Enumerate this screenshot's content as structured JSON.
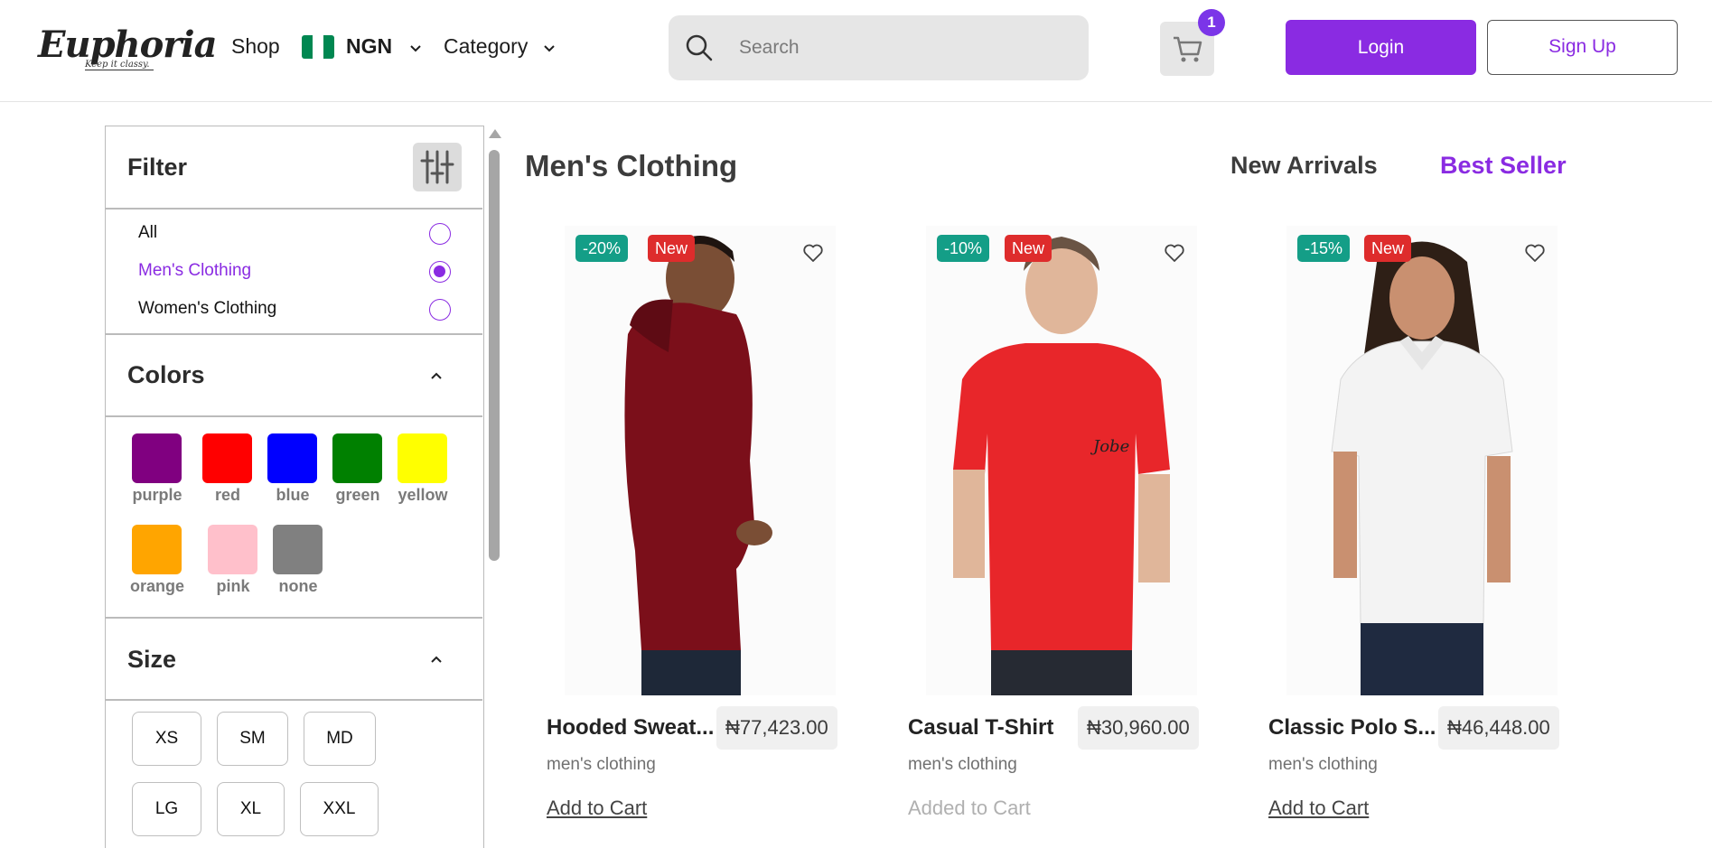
{
  "header": {
    "logo_text": "Euphoria",
    "logo_tagline": "Keep it classy.",
    "nav_shop": "Shop",
    "currency": "NGN",
    "nav_category": "Category",
    "search_placeholder": "Search",
    "cart_count": "1",
    "login_label": "Login",
    "signup_label": "Sign Up"
  },
  "sidebar": {
    "filter_title": "Filter",
    "categories": [
      {
        "label": "All",
        "selected": false
      },
      {
        "label": "Men's Clothing",
        "selected": true
      },
      {
        "label": "Women's Clothing",
        "selected": false
      }
    ],
    "colors_title": "Colors",
    "colors": [
      {
        "label": "purple",
        "hex": "#800080"
      },
      {
        "label": "red",
        "hex": "#ff0000"
      },
      {
        "label": "blue",
        "hex": "#0000ff"
      },
      {
        "label": "green",
        "hex": "#008000"
      },
      {
        "label": "yellow",
        "hex": "#ffff00"
      },
      {
        "label": "orange",
        "hex": "#ffa500"
      },
      {
        "label": "pink",
        "hex": "#ffc0cb"
      },
      {
        "label": "none",
        "hex": "#808080"
      }
    ],
    "size_title": "Size",
    "sizes": [
      "XS",
      "SM",
      "MD",
      "LG",
      "XL",
      "XXL"
    ]
  },
  "main": {
    "title": "Men's Clothing",
    "tab_new_arrivals": "New Arrivals",
    "tab_best_seller": "Best Seller",
    "products": [
      {
        "name": "Hooded Sweat...",
        "price": "₦77,423.00",
        "category": "men's clothing",
        "discount": "-20%",
        "badge": "New",
        "cart_label": "Add to Cart"
      },
      {
        "name": "Casual T-Shirt",
        "price": "₦30,960.00",
        "category": "men's clothing",
        "discount": "-10%",
        "badge": "New",
        "cart_label": "Added to Cart"
      },
      {
        "name": "Classic Polo S...",
        "price": "₦46,448.00",
        "category": "men's clothing",
        "discount": "-15%",
        "badge": "New",
        "cart_label": "Add to Cart"
      }
    ]
  },
  "colors": {
    "accent": "#8a2be2",
    "discount_badge": "#149e87",
    "new_badge": "#de2c2c"
  }
}
